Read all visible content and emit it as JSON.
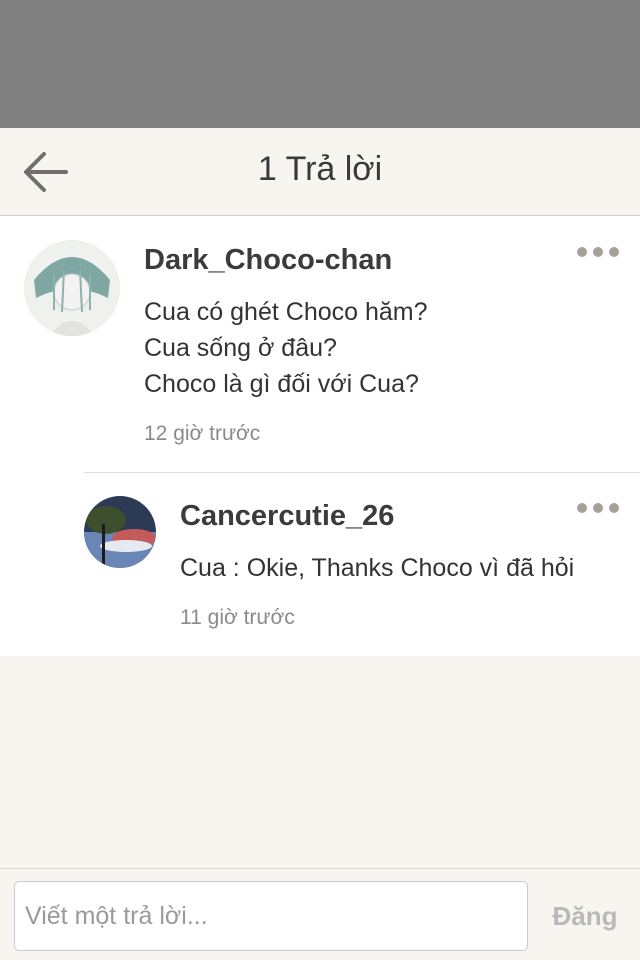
{
  "header": {
    "title": "1 Trả lời",
    "back_icon": "arrow-left-icon"
  },
  "comment": {
    "author": "Dark_Choco-chan",
    "lines": [
      "Cua có ghét Choco hăm?",
      "Cua sống ở đâu?",
      "Choco là gì đối với Cua?"
    ],
    "time": "12 giờ trước"
  },
  "reply": {
    "author": "Cancercutie_26",
    "text": "Cua : Okie, Thanks Choco vì đã hỏi",
    "time": "11 giờ trước"
  },
  "composer": {
    "placeholder": "Viết một trả lời...",
    "post_label": "Đăng"
  },
  "colors": {
    "overlay": "#808080",
    "background": "#f6f5f0",
    "muted": "#8a8a8a",
    "more_dots": "#a8a198"
  }
}
